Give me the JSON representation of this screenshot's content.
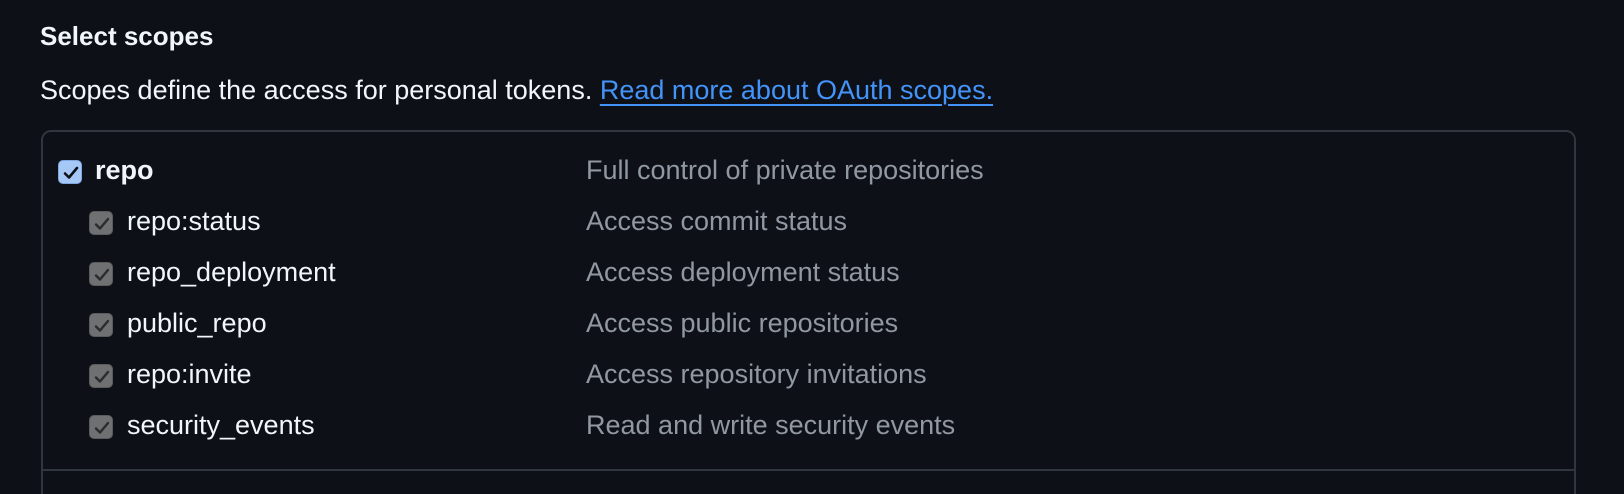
{
  "section": {
    "title": "Select scopes",
    "description": "Scopes define the access for personal tokens.",
    "link_text": "Read more about OAuth scopes."
  },
  "scopes": {
    "parent": {
      "name": "repo",
      "description": "Full control of private repositories",
      "checked": true
    },
    "children": [
      {
        "name": "repo:status",
        "description": "Access commit status",
        "checked": true
      },
      {
        "name": "repo_deployment",
        "description": "Access deployment status",
        "checked": true
      },
      {
        "name": "public_repo",
        "description": "Access public repositories",
        "checked": true
      },
      {
        "name": "repo:invite",
        "description": "Access repository invitations",
        "checked": true
      },
      {
        "name": "security_events",
        "description": "Read and write security events",
        "checked": true
      }
    ]
  },
  "colors": {
    "background": "#0d1117",
    "text": "#f0f6fc",
    "muted_text": "#9198a1",
    "link": "#4493f8",
    "border": "#30363d",
    "parent_checkbox": "#a5c8f6",
    "child_checkbox": "#6e7072"
  },
  "icons": {
    "checkbox_check": "check-icon"
  }
}
